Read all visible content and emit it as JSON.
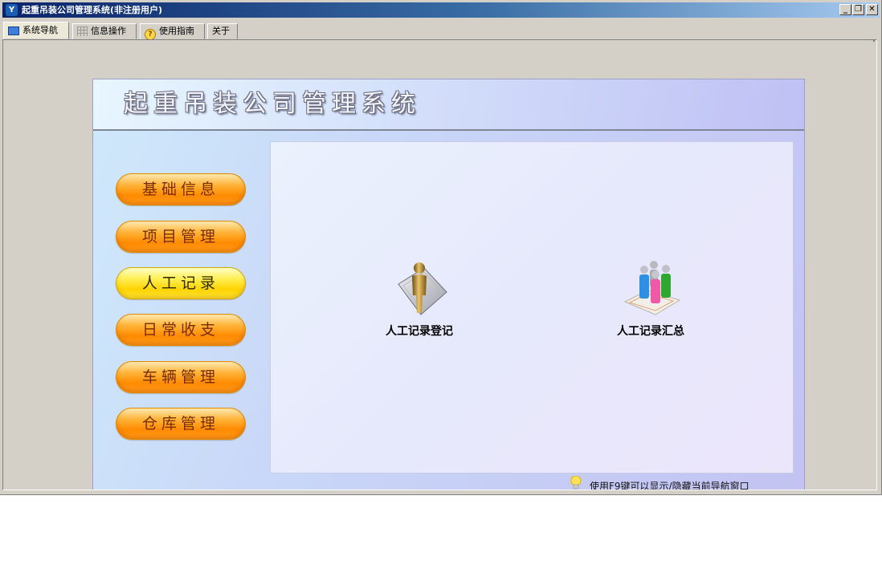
{
  "window": {
    "title": "起重吊装公司管理系统(非注册用户)",
    "app_icon_glyph": "Y",
    "buttons": {
      "minimize": "_",
      "restore": "❐",
      "close": "✕"
    }
  },
  "tabs": [
    {
      "label": "系统导航",
      "icon": "monitor-icon",
      "active": true
    },
    {
      "label": "信息操作",
      "icon": "grid-icon",
      "active": false
    },
    {
      "label": "使用指南",
      "icon": "help-icon",
      "active": false
    },
    {
      "label": "关于",
      "icon": "",
      "active": false
    }
  ],
  "banner": {
    "title": "起重吊装公司管理系统"
  },
  "menu": [
    {
      "label": "基础信息",
      "style": "orange"
    },
    {
      "label": "项目管理",
      "style": "orange"
    },
    {
      "label": "人工记录",
      "style": "yellow",
      "selected": true
    },
    {
      "label": "日常收支",
      "style": "orange"
    },
    {
      "label": "车辆管理",
      "style": "orange"
    },
    {
      "label": "仓库管理",
      "style": "orange"
    }
  ],
  "features": [
    {
      "label": "人工记录登记",
      "icon": "person-document-icon"
    },
    {
      "label": "人工记录汇总",
      "icon": "people-group-icon"
    }
  ],
  "hint": {
    "text": "使用F9键可以显示/隐藏当前导航窗口",
    "icon": "lightbulb-icon"
  },
  "colors": {
    "title_bar_start": "#0a246a",
    "menu_orange": "#ff8a00",
    "menu_selected_yellow": "#ffd400",
    "panel_bg": "#c9d8f8"
  }
}
